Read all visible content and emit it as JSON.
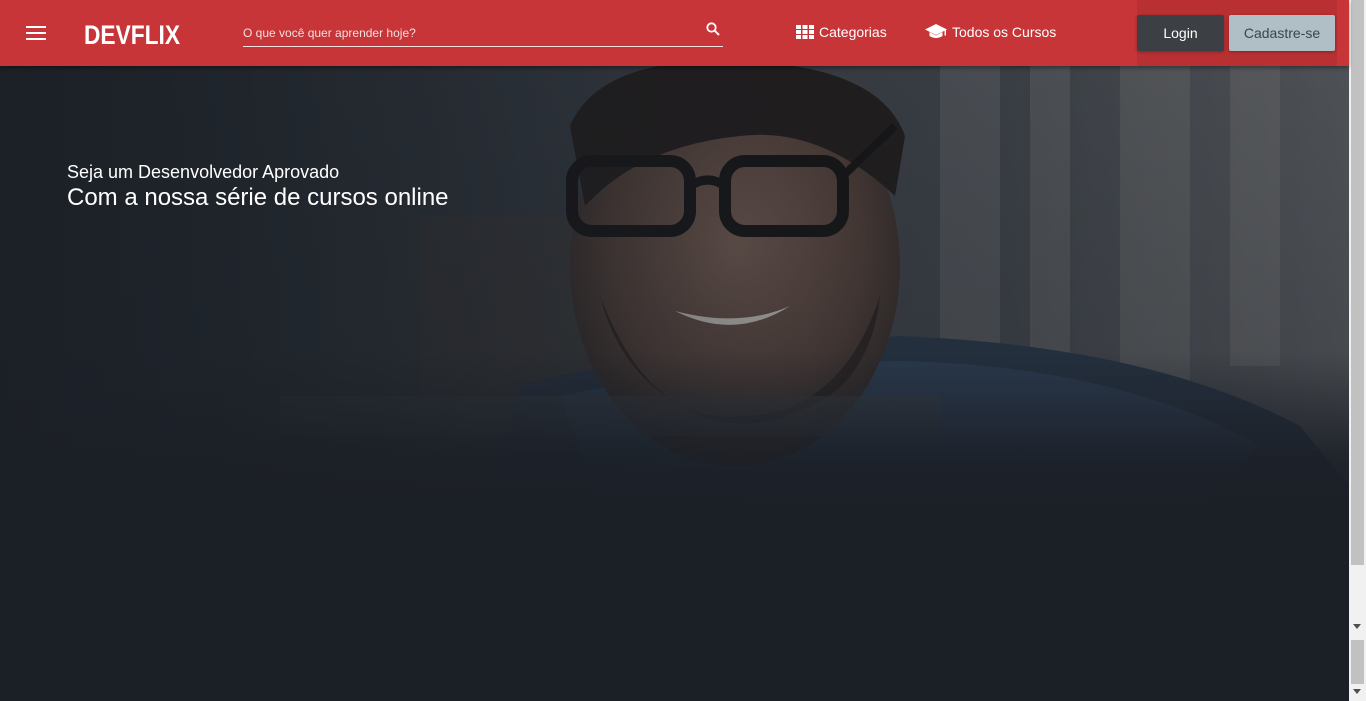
{
  "header": {
    "logo_text": "DEVFLIX",
    "search": {
      "placeholder": "O que você quer aprender hoje?",
      "value": ""
    },
    "nav": {
      "categories": "Categorias",
      "all_courses": "Todos os Cursos"
    },
    "auth": {
      "login": "Login",
      "signup": "Cadastre-se"
    }
  },
  "hero": {
    "subtitle": "Seja um Desenvolvedor Aprovado",
    "title": "Com a nossa série de cursos online"
  },
  "colors": {
    "header_bg": "#c73538",
    "hero_bg": "#1b1f26",
    "login_bg": "#3c3f43",
    "signup_bg": "#b0bec5"
  },
  "icons": [
    "menu-icon",
    "search-icon",
    "grid-icon",
    "graduation-cap-icon"
  ]
}
